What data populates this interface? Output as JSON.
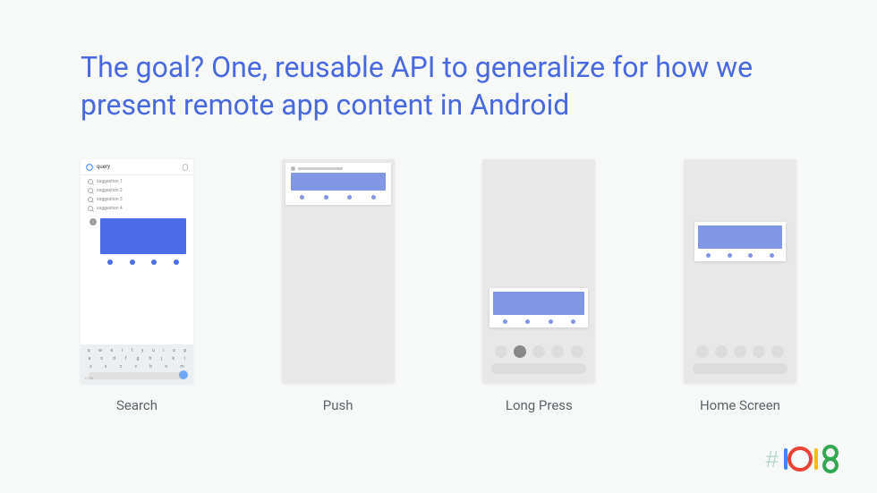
{
  "title": "The goal? One, reusable API to generalize for how we present remote app content in Android",
  "cards": [
    {
      "label": "Search"
    },
    {
      "label": "Push"
    },
    {
      "label": "Long Press"
    },
    {
      "label": "Home Screen"
    }
  ],
  "search": {
    "query": "query",
    "suggestions": [
      "suggestion 1",
      "suggestion 2",
      "suggestion 3",
      "suggestion 4"
    ],
    "keyboard": {
      "row1": [
        "q",
        "w",
        "e",
        "r",
        "t",
        "y",
        "u",
        "i",
        "o",
        "p"
      ],
      "row2": [
        "a",
        "s",
        "d",
        "f",
        "g",
        "h",
        "j",
        "k",
        "l"
      ],
      "row3": [
        "z",
        "x",
        "c",
        "v",
        "b",
        "n",
        "m"
      ],
      "time": "11:23"
    }
  },
  "logo": {
    "hash": "#",
    "text": "io18"
  }
}
